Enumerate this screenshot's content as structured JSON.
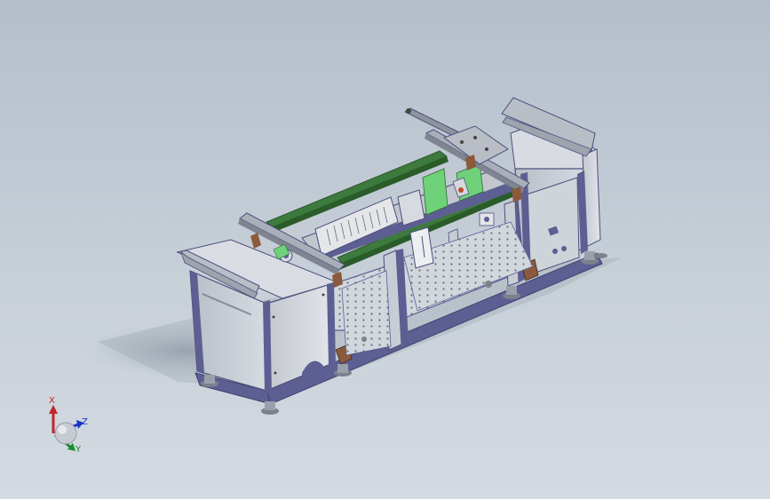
{
  "app": {
    "kind": "3d-cad-model-viewport"
  },
  "viewport": {
    "background_top": "#b4bfcb",
    "background_bottom": "#d4dae1"
  },
  "model": {
    "frame_color": "#5d5f93",
    "panel_color": "#c6cbd4",
    "rail_color": "#3d7a3d",
    "accent_green": "#6fd17a",
    "bracket_color": "#8b5a3c"
  },
  "triad": {
    "x_label": "X",
    "y_label": "Y",
    "z_label": "Z",
    "x_color": "#c0262a",
    "y_color": "#1a8c2a",
    "z_color": "#1d33c8"
  }
}
